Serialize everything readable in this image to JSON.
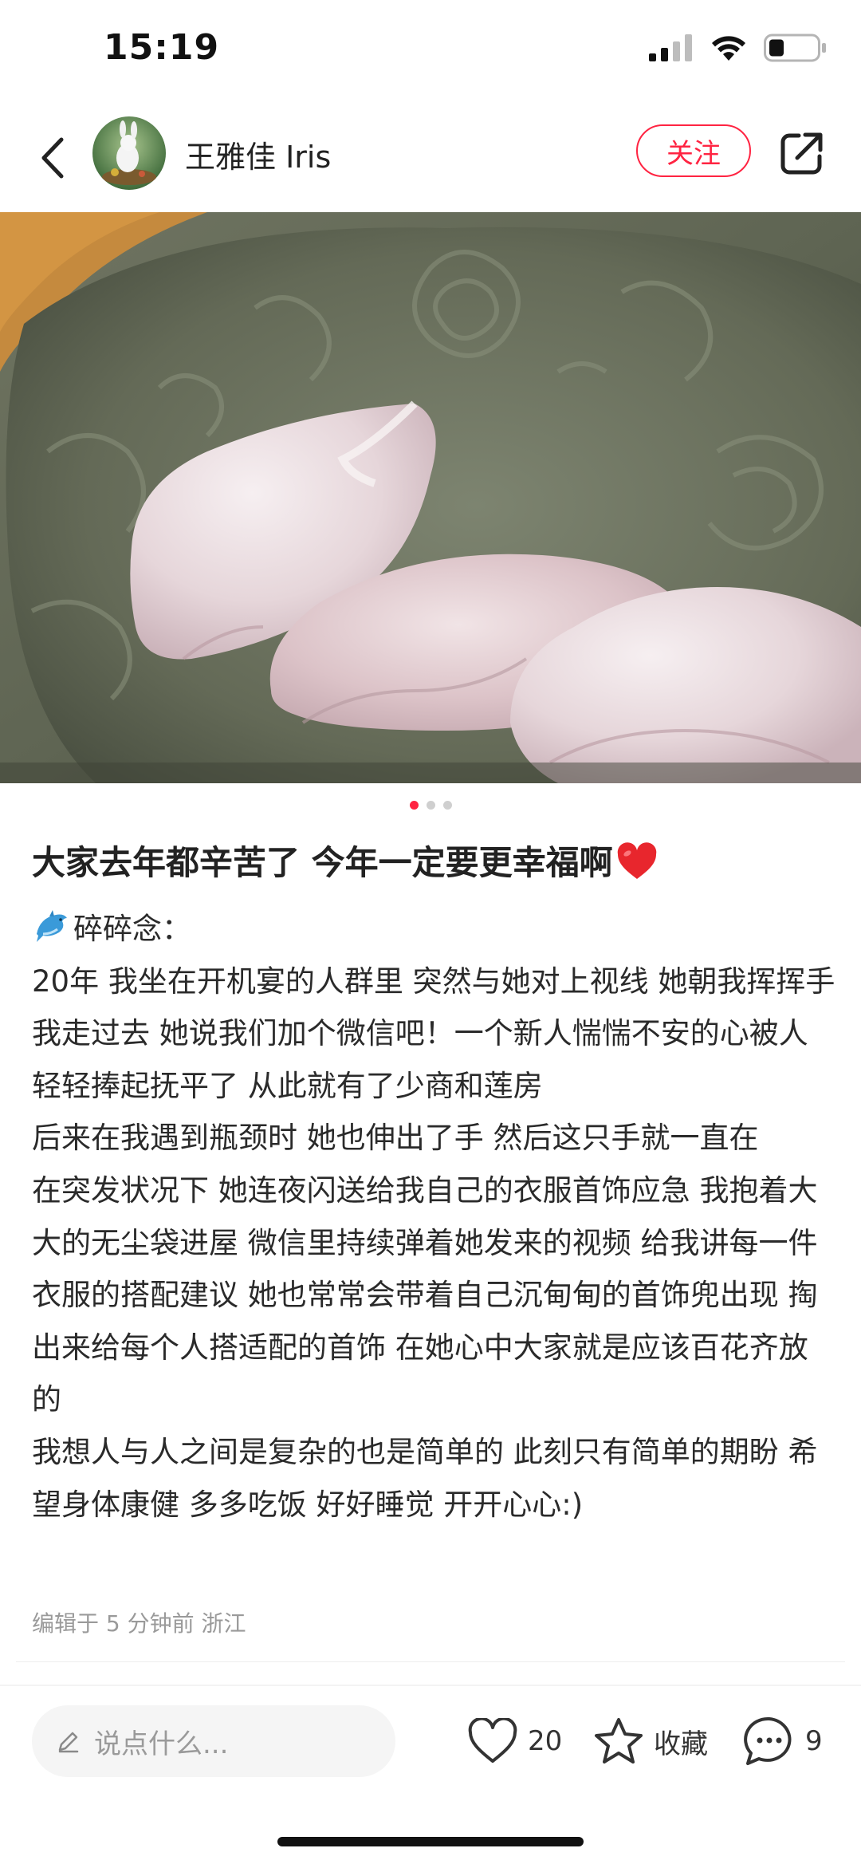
{
  "status_bar": {
    "time": "15:19"
  },
  "header": {
    "author_name": "王雅佳 Iris",
    "follow_label": "关注"
  },
  "carousel": {
    "total": 3,
    "active_index": 0
  },
  "post": {
    "title": "大家去年都辛苦了 今年一定要更幸福啊",
    "paragraphs": [
      "碎碎念：",
      "20年 我坐在开机宴的人群里 突然与她对上视线 她朝我挥挥手 我走过去 她说我们加个微信吧！一个新人惴惴不安的心被人轻轻捧起抚平了 从此就有了少商和莲房",
      "后来在我遇到瓶颈时 她也伸出了手 然后这只手就一直在",
      "在突发状况下 她连夜闪送给我自己的衣服首饰应急 我抱着大大的无尘袋进屋 微信里持续弹着她发来的视频 给我讲每一件衣服的搭配建议 她也常常会带着自己沉甸甸的首饰兜出现 掏出来给每个人搭适配的首饰 在她心中大家就是应该百花齐放的",
      "我想人与人之间是复杂的也是简单的 此刻只有简单的期盼 希望身体康健 多多吃饭 好好睡觉 开开心心:)"
    ],
    "meta": "编辑于 5 分钟前 浙江"
  },
  "bottom_bar": {
    "comment_placeholder": "说点什么...",
    "likes": "20",
    "collect_label": "收藏",
    "comments": "9"
  },
  "colors": {
    "accent": "#ff2442"
  },
  "icons": [
    "back-arrow-icon",
    "share-icon",
    "heart-emoji-icon",
    "dolphin-emoji-icon",
    "pencil-icon",
    "heart-outline-icon",
    "star-outline-icon",
    "comment-bubble-icon"
  ]
}
